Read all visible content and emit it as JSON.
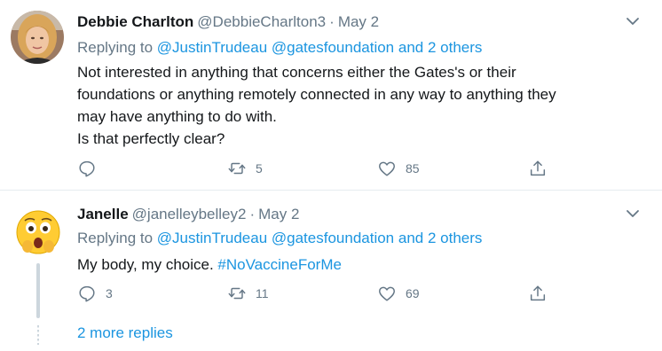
{
  "tweets": [
    {
      "name": "Debbie Charlton",
      "handle": "@DebbieCharlton3",
      "separator": "·",
      "date": "May 2",
      "replying_prefix": "Replying to",
      "replying_to": [
        "@JustinTrudeau",
        "@gatesfoundation"
      ],
      "replying_and": "and",
      "replying_others": "2 others",
      "text_lines": [
        "Not interested in anything that concerns either the Gates's or their",
        "foundations or anything remotely connected in any way to anything they",
        "may have anything to do with.",
        "Is that perfectly clear?"
      ],
      "replies": "",
      "retweets": "5",
      "likes": "85",
      "avatar_icon": "woman-portrait-avatar",
      "colors": {
        "avatar_bg": "#b48a6a",
        "hair": "#d9a55a"
      }
    },
    {
      "name": "Janelle",
      "handle": "@janelleybelley2",
      "separator": "·",
      "date": "May 2",
      "replying_prefix": "Replying to",
      "replying_to": [
        "@JustinTrudeau",
        "@gatesfoundation"
      ],
      "replying_and": "and",
      "replying_others": "2 others",
      "text_plain": "My body, my choice.",
      "hashtag": "#NoVaccineForMe",
      "replies": "3",
      "retweets": "11",
      "likes": "69",
      "avatar_icon": "shocked-face-emoji-avatar",
      "more_replies": "2 more replies"
    }
  ],
  "colors": {
    "text": "#14171a",
    "secondary": "#657786",
    "link": "#1b95e0",
    "divider": "#e6ecf0",
    "thread_line": "#ccd6dd"
  },
  "icons": [
    "reply-icon",
    "retweet-icon",
    "like-icon",
    "share-icon",
    "chevron-down-icon"
  ]
}
